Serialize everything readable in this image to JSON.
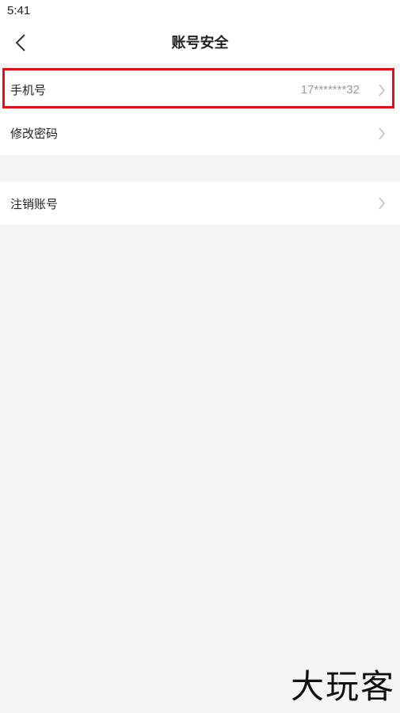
{
  "status_bar": {
    "time": "5:41"
  },
  "nav": {
    "back_icon": "chevron-left-icon",
    "title": "账号安全"
  },
  "settings": {
    "phone": {
      "label": "手机号",
      "value": "17*******32"
    },
    "change_password": {
      "label": "修改密码"
    },
    "delete_account": {
      "label": "注销账号"
    }
  },
  "highlight_color": "#e0101b",
  "watermark": "大玩客"
}
